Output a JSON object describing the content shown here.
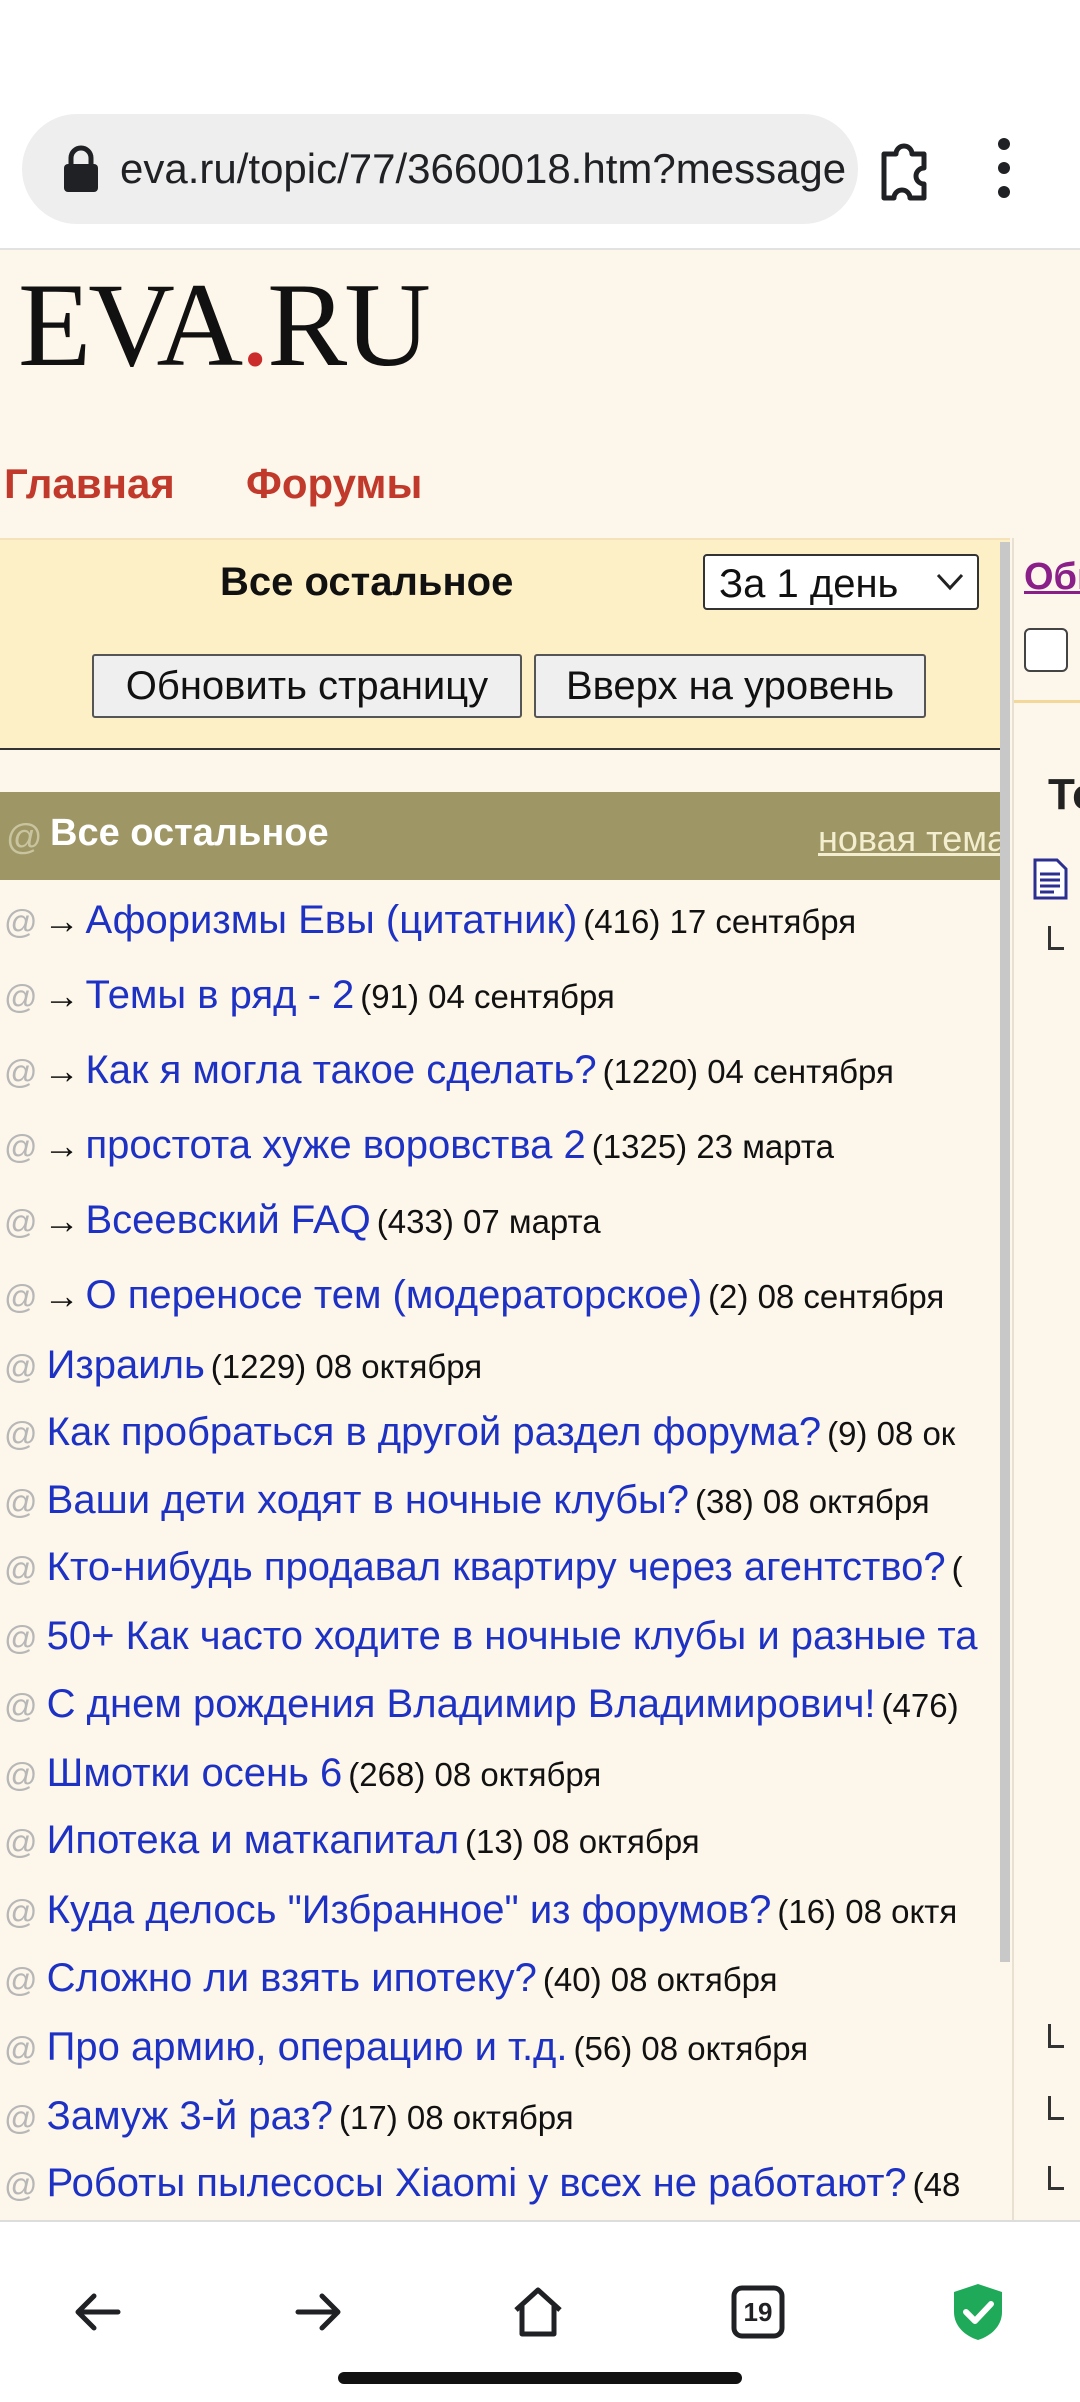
{
  "browser": {
    "url": "eva.ru/topic/77/3660018.htm?message",
    "tab_count": "19",
    "icons": [
      "lock-icon",
      "extension-puzzle-icon",
      "more-vert-icon",
      "back-arrow-icon",
      "forward-arrow-icon",
      "home-icon",
      "tabs-icon",
      "shield-check-icon"
    ],
    "shield_color": "#1faa59"
  },
  "site": {
    "logo_main": "EVA",
    "logo_dot": ".",
    "logo_tail": "RU",
    "nav": {
      "home": "Главная",
      "forums": "Форумы"
    }
  },
  "panel": {
    "title": "Все остальное",
    "period_selected": "За 1 день",
    "refresh_button": "Обновить страницу",
    "up_button": "Вверх на уровень"
  },
  "section": {
    "at": "@",
    "title": "Все остальное",
    "new_topic": "новая тема"
  },
  "topics": [
    {
      "arrow": "→",
      "title": "Афоризмы Евы (цитатник)",
      "meta": "(416) 17 сентября"
    },
    {
      "arrow": "→",
      "title": "Темы в ряд - 2",
      "meta": "(91) 04 сентября"
    },
    {
      "arrow": "→",
      "title": "Как я могла такое сделать?",
      "meta": "(1220) 04 сентября"
    },
    {
      "arrow": "→",
      "title": "простота хуже воровства 2",
      "meta": "(1325) 23 марта"
    },
    {
      "arrow": "→",
      "title": "Всеевский FAQ",
      "meta": "(433) 07 марта"
    },
    {
      "arrow": "→",
      "title": "О переносе тем (модераторское)",
      "meta": "(2) 08 сентября"
    },
    {
      "arrow": "",
      "title": "Израиль",
      "meta": "(1229) 08 октября"
    },
    {
      "arrow": "",
      "title": "Как пробраться в другой раздел форума?",
      "meta": "(9) 08 ок"
    },
    {
      "arrow": "",
      "title": "Ваши дети ходят в ночные клубы?",
      "meta": "(38) 08 октября"
    },
    {
      "arrow": "",
      "title": "Кто-нибудь продавал квартиру через агентство?",
      "meta": "("
    },
    {
      "arrow": "",
      "title": "50+ Как часто ходите в ночные клубы и разные та",
      "meta": ""
    },
    {
      "arrow": "",
      "title": "С днем рождения Владимир Владимирович!",
      "meta": "(476)"
    },
    {
      "arrow": "",
      "title": "Шмотки осень 6",
      "meta": "(268) 08 октября"
    },
    {
      "arrow": "",
      "title": "Ипотека и маткапитал",
      "meta": "(13) 08 октября"
    },
    {
      "arrow": "",
      "title": "Куда делось \"Избранное\" из форумов?",
      "meta": "(16) 08 октя"
    },
    {
      "arrow": "",
      "title": "Сложно ли взять ипотеку?",
      "meta": "(40) 08 октября"
    },
    {
      "arrow": "",
      "title": "Про армию, операцию и т.д.",
      "meta": "(56) 08 октября"
    },
    {
      "arrow": "",
      "title": "Замуж 3-й раз?",
      "meta": "(17) 08 октября"
    },
    {
      "arrow": "",
      "title": "Роботы пылесосы Xiaomi у всех не работают?",
      "meta": "(48"
    }
  ],
  "right_column": {
    "link": "Общ",
    "heading": "То"
  }
}
